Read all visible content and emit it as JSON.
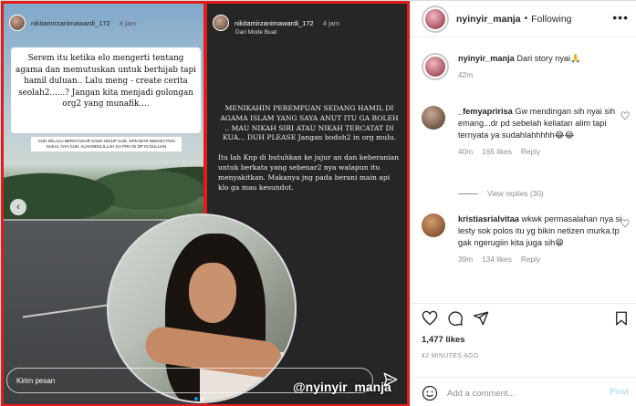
{
  "story_left": {
    "username": "nikitamirzanimawardi_172",
    "time": "4 jam",
    "text": "Serem itu ketika elo mengerti tentang agama dan memutuskan untuk berhijab tapi hamil duluan.. Lalu meng - create cerita seolah2......? Jangan kita menjadi golongan org2 yang munafik....",
    "note": "GUE SELALU BERSYUKUR SAMA HIDUP GUE, KRN BIAR BIMANA PUN NAKAL NYA GUE, ALHAMDULILLAH GA PRH DI DP IN DULUAN"
  },
  "story_right": {
    "username": "nikitamirzanimawardi_172",
    "time": "4 jam",
    "subtitle": "Dari Mode Buat",
    "para1": "MENIKAHIN PEREMPUAN SEDANG HAMIL DI AGAMA ISLAM YANG SAYA ANUT ITU GA BOLEH .. MAU NIKAH SIRI ATAU NIKAH TERCATAT DI KUA... DUH PLEASE Jangan bodoh2 in org mulu.",
    "para2": "Itu lah Knp di butuhkan ke jujur an dan keberanian untuk berkata yang sebenar2 nya walapun itu menyakitkan. Makanya jng pada berani main api klo ga mau kesundut."
  },
  "watermark": "@nyinyir_manja",
  "message_placeholder": "Kirim pesan",
  "panel": {
    "header": {
      "username": "nyinyir_manja",
      "separator": "•",
      "follow": "Following",
      "more": "•••"
    },
    "caption": {
      "username": "nyinyir_manja",
      "text": "Dari story nyai🙏",
      "time": "42m"
    },
    "comments": [
      {
        "username": "_femyapririsa",
        "text": "Gw mendingan sih nyai sih emang...dr pd sebelah keliatan alim tapi ternyata ya sudahlahhhhh😂😂",
        "time": "40m",
        "likes": "165 likes",
        "reply": "Reply"
      },
      {
        "username": "kristiasrialvitaa",
        "text": "wkwk permasalahan nya si lesty sok polos itu yg bikin netizen murka.tp gak ngerugiin kita juga sih😁",
        "time": "39m",
        "likes": "134 likes",
        "reply": "Reply"
      }
    ],
    "view_replies": "View replies (30)",
    "likes_count": "1,477 likes",
    "posted_ago": "42 MINUTES AGO",
    "add_comment_placeholder": "Add a comment...",
    "post_label": "Post"
  },
  "colors": {
    "story_border": "#e41b1b",
    "link_blue": "#0095f6",
    "muted": "#8e8e8e"
  }
}
